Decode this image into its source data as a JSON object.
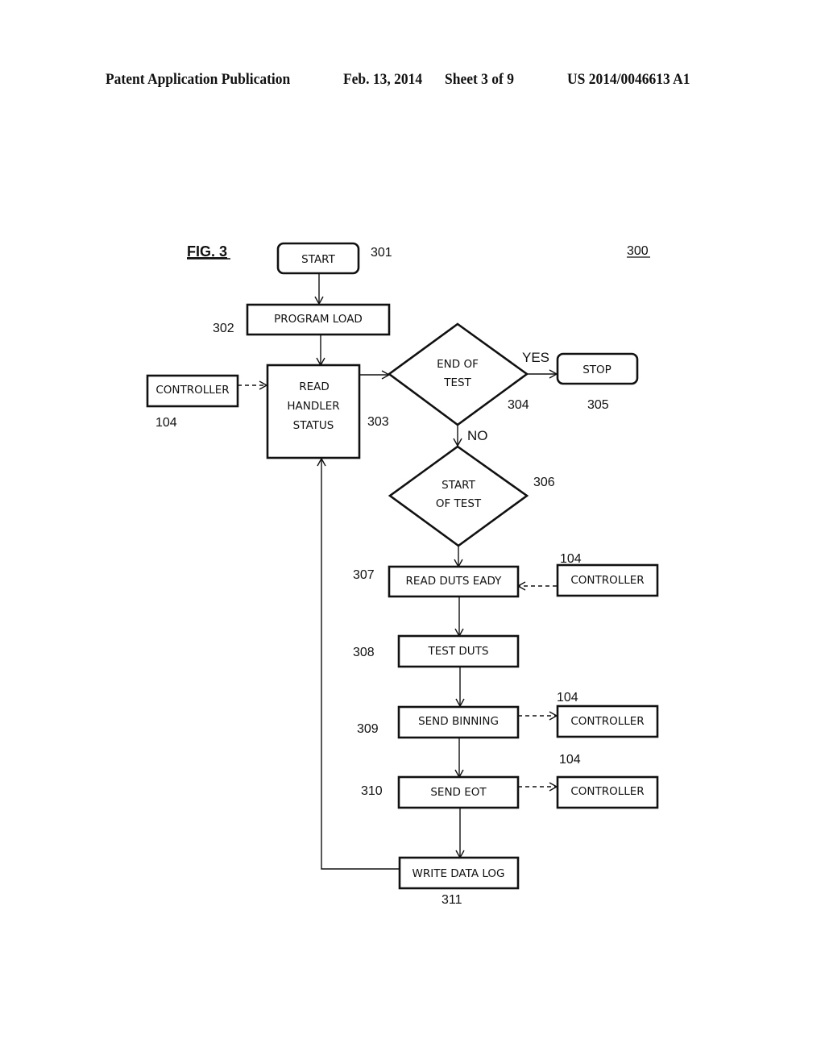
{
  "header": {
    "publication": "Patent Application Publication",
    "date": "Feb. 13, 2014",
    "sheet": "Sheet 3 of 9",
    "number": "US 2014/0046613 A1"
  },
  "figure": {
    "label": "FIG. 3",
    "ref": "300"
  },
  "nodes": {
    "start": {
      "text": "START",
      "ref": "301"
    },
    "program_load": {
      "text": "PROGRAM LOAD",
      "ref": "302"
    },
    "read_handler": {
      "lines": [
        "READ",
        "HANDLER",
        "STATUS"
      ],
      "ref": "303"
    },
    "end_of_test": {
      "lines": [
        "END OF",
        "TEST"
      ],
      "ref": "304"
    },
    "stop": {
      "text": "STOP",
      "ref": "305"
    },
    "start_of_test": {
      "lines": [
        "START",
        "OF TEST"
      ],
      "ref": "306"
    },
    "read_duts": {
      "text": "READ DUTS EADY",
      "ref": "307"
    },
    "test_duts": {
      "text": "TEST DUTS",
      "ref": "308"
    },
    "send_binning": {
      "text": "SEND BINNING",
      "ref": "309"
    },
    "send_eot": {
      "text": "SEND EOT",
      "ref": "310"
    },
    "write_log": {
      "text": "WRITE DATA LOG",
      "ref": "311"
    }
  },
  "controllers": [
    {
      "text": "CONTROLLER",
      "ref": "104"
    },
    {
      "text": "CONTROLLER",
      "ref": "104"
    },
    {
      "text": "CONTROLLER",
      "ref": "104"
    },
    {
      "text": "CONTROLLER",
      "ref": "104"
    }
  ],
  "edges": {
    "yes": "YES",
    "no": "NO"
  }
}
